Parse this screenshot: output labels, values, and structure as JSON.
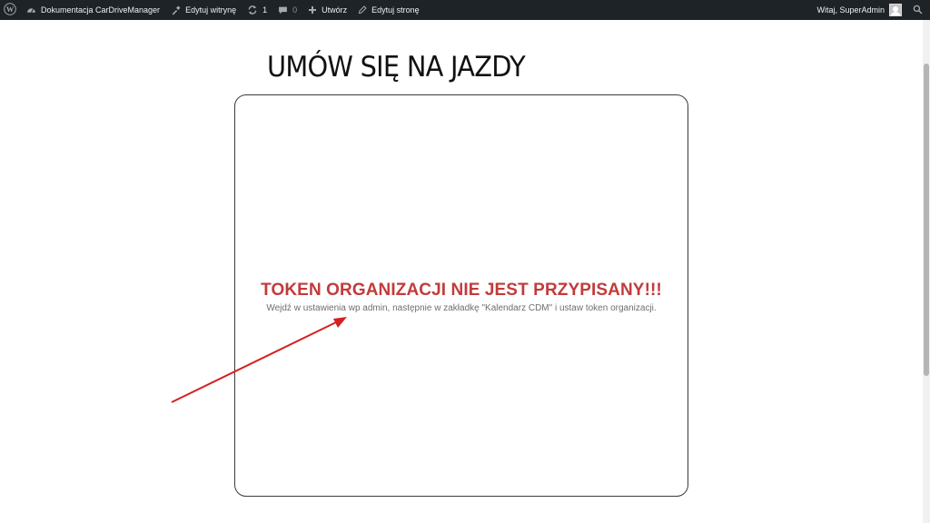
{
  "adminbar": {
    "site_name": "Dokumentacja CarDriveManager",
    "edit_site": "Edytuj witrynę",
    "updates_count": "1",
    "comments_count": "0",
    "new_label": "Utwórz",
    "edit_page": "Edytuj stronę",
    "greeting": "Witaj, SuperAdmin"
  },
  "page": {
    "title": "UMÓW SIĘ NA JAZDY"
  },
  "calendar": {
    "error_title": "TOKEN ORGANIZACJI NIE JEST PRZYPISANY!!!",
    "error_message": "Wejdź w ustawienia wp admin, następnie w zakładkę \"Kalendarz CDM\" i ustaw token organizacji."
  },
  "colors": {
    "adminbar_bg": "#1d2327",
    "error_red": "#c23b3b",
    "annotation_arrow": "#d42020"
  },
  "icons": [
    "wordpress-logo-icon",
    "dashboard-icon",
    "customize-icon",
    "updates-icon",
    "comment-icon",
    "plus-icon",
    "pencil-icon",
    "avatar",
    "search-icon"
  ]
}
